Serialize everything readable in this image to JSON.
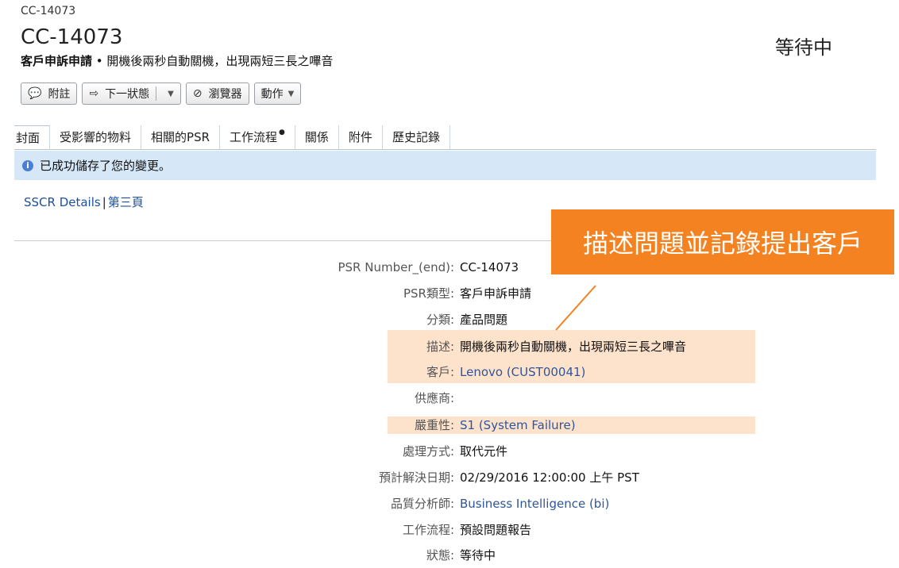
{
  "breadcrumb": "CC-14073",
  "title": "CC-14073",
  "subtitle": {
    "type": "客戶申訴申請",
    "sep": " • ",
    "desc": "開機後兩秒自動關機，出現兩短三長之嗶音"
  },
  "status_top": "等待中",
  "toolbar": {
    "comment": "附註",
    "next_state": "下一狀態",
    "browser": "瀏覽器",
    "actions": "動作"
  },
  "tabs": [
    "封面",
    "受影響的物料",
    "相關的PSR",
    "工作流程",
    "關係",
    "附件",
    "歷史記錄"
  ],
  "notice": "已成功儲存了您的變更。",
  "sublinks": {
    "details": "SSCR Details",
    "bar": "|",
    "page3": "第三頁"
  },
  "callout": "描述問題並記錄提出客戶",
  "fields": [
    {
      "label": "PSR Number_(end):",
      "value": "CC-14073"
    },
    {
      "label": "PSR類型:",
      "value": "客戶申訴申請"
    },
    {
      "label": "分類:",
      "value": "產品問題"
    },
    {
      "label": "描述:",
      "value": "開機後兩秒自動關機，出現兩短三長之嗶音"
    },
    {
      "label": "客戶:",
      "value": "Lenovo (CUST00041)"
    },
    {
      "label": "供應商:",
      "value": ""
    },
    {
      "label": "嚴重性:",
      "value": "S1 (System Failure)"
    },
    {
      "label": "處理方式:",
      "value": "取代元件"
    },
    {
      "label": "預計解決日期:",
      "value": "02/29/2016 12:00:00 上午 PST"
    },
    {
      "label": "品質分析師:",
      "value": "Business Intelligence (bi)"
    },
    {
      "label": "工作流程:",
      "value": "預設問題報告"
    },
    {
      "label": "狀態:",
      "value": "等待中"
    }
  ],
  "colors": {
    "accent": "#f58220",
    "highlight": "#fde2cc",
    "notice": "#d6e8f8",
    "link": "#30559a"
  },
  "icons": {
    "comment": "speech-bubble-icon",
    "next_state": "arrow-right-box-icon",
    "browser": "no-entry-icon",
    "notice": "info-icon"
  }
}
